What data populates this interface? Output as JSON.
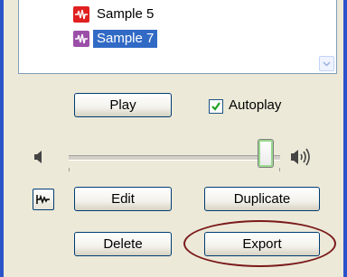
{
  "list": {
    "items": [
      {
        "label": "Sample 5",
        "icon": "audio-file-icon",
        "selected": false
      },
      {
        "label": "Sample 7",
        "icon": "audio-file-icon",
        "selected": true
      }
    ]
  },
  "controls": {
    "play_label": "Play",
    "autoplay_label": "Autoplay",
    "autoplay_checked": true,
    "volume_level": 0.93,
    "edit_label": "Edit",
    "duplicate_label": "Duplicate",
    "delete_label": "Delete",
    "export_label": "Export"
  },
  "colors": {
    "selection": "#316ac5",
    "window_border": "#2a52c9",
    "highlight_oval": "#7a1a1a",
    "checkmark": "#21a121"
  }
}
